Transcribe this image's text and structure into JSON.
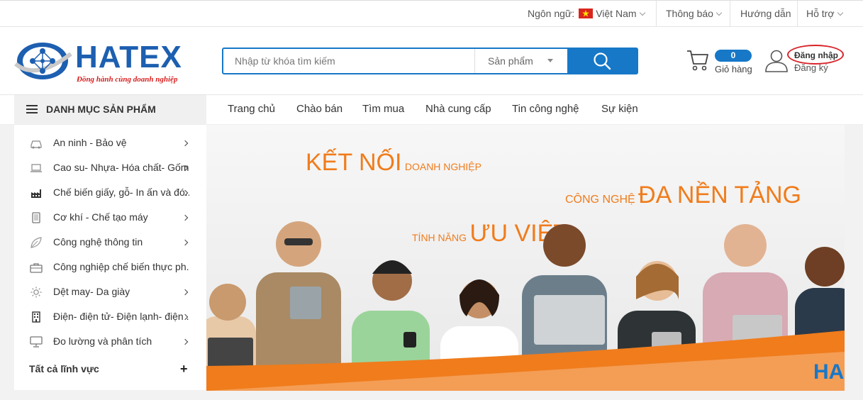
{
  "topbar": {
    "language_label": "Ngôn ngữ:",
    "language_value": "Việt Nam",
    "notifications": "Thông báo",
    "guide": "Hướng dẫn",
    "support": "Hỗ trợ"
  },
  "logo": {
    "name": "HATEX",
    "slogan": "Đồng hành cùng doanh nghiệp"
  },
  "search": {
    "placeholder": "Nhập từ khóa tìm kiếm",
    "category": "Sản phẩm"
  },
  "cart": {
    "count": "0",
    "label": "Giỏ hàng"
  },
  "account": {
    "login": "Đăng nhập",
    "register": "Đăng ký"
  },
  "nav": {
    "category_title": "DANH MỤC SẢN PHẨM",
    "items": [
      "Trang chủ",
      "Chào bán",
      "Tìm mua",
      "Nhà cung cấp",
      "Tin công nghệ",
      "Sự kiện"
    ]
  },
  "sidebar": {
    "items": [
      {
        "label": "An ninh - Bảo vệ",
        "icon": "car-icon"
      },
      {
        "label": "Cao su- Nhựa- Hóa chất- Gốm",
        "icon": "laptop-icon"
      },
      {
        "label": "Chế biến giấy, gỗ- In ấn và đó..",
        "icon": "factory-icon"
      },
      {
        "label": "Cơ khí - Chế tạo máy",
        "icon": "tablet-icon"
      },
      {
        "label": "Công nghệ thông tin",
        "icon": "leaf-icon"
      },
      {
        "label": "Công nghiệp chế biến thực ph..",
        "icon": "briefcase-icon"
      },
      {
        "label": "Dệt may- Da giày",
        "icon": "sun-icon"
      },
      {
        "label": "Điện- điện tử- Điện lạnh- điện ..",
        "icon": "building-icon"
      },
      {
        "label": "Đo lường và phân tích",
        "icon": "monitor-icon"
      }
    ],
    "all_fields": "Tất cả lĩnh vực",
    "all_plus": "+"
  },
  "banner": {
    "line1_big": "KẾT NỐI",
    "line1_small": "DOANH NGHIỆP",
    "line2_small": "CÔNG NGHỆ",
    "line2_big": "ĐA NỀN TẢNG",
    "line3_small": "TÍNH NĂNG",
    "line3_big": "ƯU VIỆT",
    "corner_text": "HA"
  },
  "colors": {
    "brand_blue": "#1778c8",
    "accent_orange": "#f07c1c",
    "highlight_red": "#d8232a"
  }
}
